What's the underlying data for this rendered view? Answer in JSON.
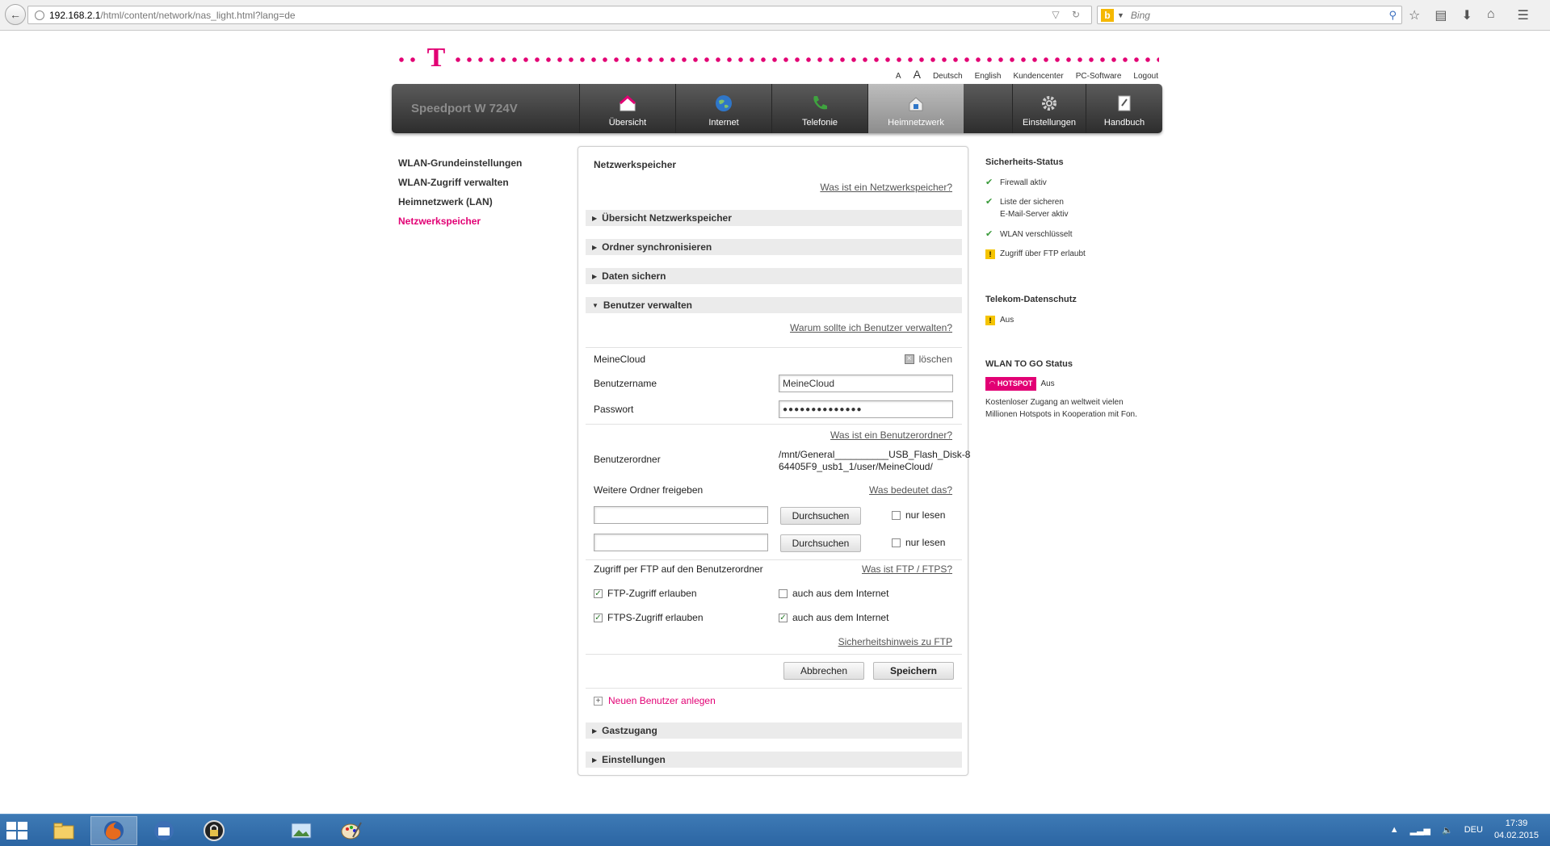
{
  "browser": {
    "url_host": "192.168.2.1",
    "url_path": "/html/content/network/nas_light.html?lang=de",
    "search_placeholder": "Bing"
  },
  "top_links": {
    "font_small": "A",
    "font_large": "A",
    "items": [
      "Deutsch",
      "English",
      "Kundencenter",
      "PC-Software",
      "Logout"
    ]
  },
  "nav": {
    "product": "Speedport W 724V",
    "tabs": [
      {
        "label": "Übersicht",
        "icon": "house-icon"
      },
      {
        "label": "Internet",
        "icon": "globe-icon"
      },
      {
        "label": "Telefonie",
        "icon": "phone-icon"
      },
      {
        "label": "Heimnetzwerk",
        "icon": "network-house-icon",
        "active": true
      },
      {
        "label": "Einstellungen",
        "icon": "gear-icon"
      },
      {
        "label": "Handbuch",
        "icon": "book-icon"
      }
    ]
  },
  "left_nav": [
    {
      "label": "WLAN-Grundeinstellungen"
    },
    {
      "label": "WLAN-Zugriff verwalten"
    },
    {
      "label": "Heimnetzwerk (LAN)"
    },
    {
      "label": "Netzwerkspeicher",
      "active": true
    }
  ],
  "panel": {
    "title": "Netzwerkspeicher",
    "help_link": "Was ist ein Netzwerkspeicher?",
    "sections": {
      "overview": "Übersicht Netzwerkspeicher",
      "sync": "Ordner synchronisieren",
      "backup": "Daten sichern",
      "users": "Benutzer verwalten",
      "guest": "Gastzugang",
      "settings": "Einstellungen"
    },
    "users_help": "Warum sollte ich Benutzer verwalten?",
    "user_name_title": "MeineCloud",
    "delete_label": "löschen",
    "username_label": "Benutzername",
    "username_value": "MeineCloud",
    "password_label": "Passwort",
    "password_value": "●●●●●●●●●●●●●●",
    "userfolder_help": "Was ist ein Benutzerordner?",
    "userfolder_label": "Benutzerordner",
    "userfolder_value": "/mnt/General__________USB_Flash_Disk-864405F9_usb1_1/user/MeineCloud/",
    "more_folders_label": "Weitere Ordner freigeben",
    "more_folders_help": "Was bedeutet das?",
    "browse_label": "Durchsuchen",
    "readonly_label": "nur lesen",
    "ftp_label": "Zugriff per FTP auf den Benutzerordner",
    "ftp_help": "Was ist FTP / FTPS?",
    "ftp_allow": "FTP-Zugriff erlauben",
    "ftps_allow": "FTPS-Zugriff erlauben",
    "internet_too": "auch aus dem Internet",
    "ftp_security_link": "Sicherheitshinweis zu FTP",
    "cancel": "Abbrechen",
    "save": "Speichern",
    "new_user": "Neuen Benutzer anlegen"
  },
  "status": {
    "security_title": "Sicherheits-Status",
    "firewall": "Firewall aktiv",
    "mailserver_1": "Liste der sicheren",
    "mailserver_2": "E-Mail-Server aktiv",
    "wlan": "WLAN verschlüsselt",
    "ftp": "Zugriff über FTP erlaubt",
    "privacy_title": "Telekom-Datenschutz",
    "privacy_value": "Aus",
    "togo_title": "WLAN TO GO Status",
    "hotspot_badge": "HOTSPOT",
    "hotspot_value": "Aus",
    "hotspot_text": "Kostenloser Zugang an weltweit vielen Millionen Hotspots in Kooperation mit Fon."
  },
  "taskbar": {
    "lang": "DEU",
    "time": "17:39",
    "date": "04.02.2015"
  },
  "colors": {
    "magenta": "#e20074",
    "nav_dark": "#2d2d2d"
  }
}
